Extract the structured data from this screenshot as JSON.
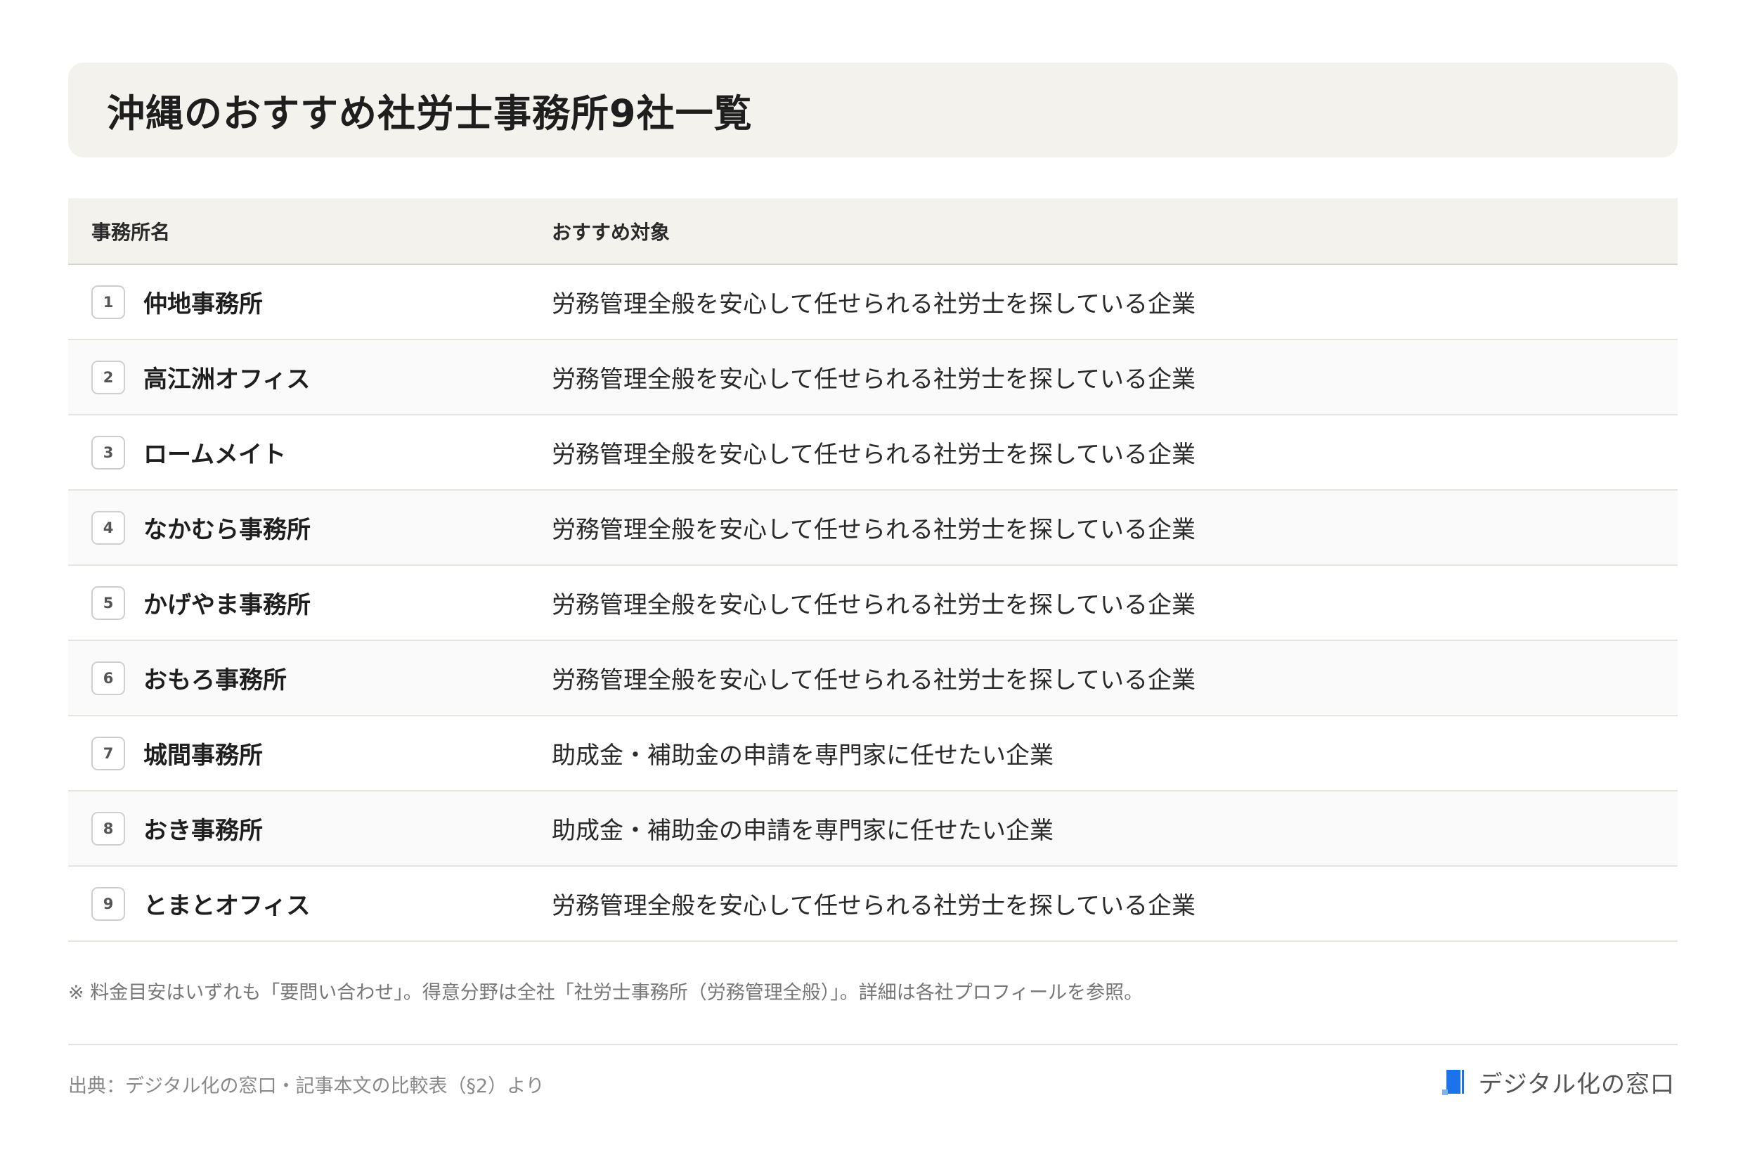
{
  "title": "沖縄のおすすめ社労士事務所9社一覧",
  "table": {
    "headers": {
      "name": "事務所名",
      "target": "おすすめ対象"
    },
    "rows": [
      {
        "num": "1",
        "name": "仲地事務所",
        "target": "労務管理全般を安心して任せられる社労士を探している企業"
      },
      {
        "num": "2",
        "name": "高江洲オフィス",
        "target": "労務管理全般を安心して任せられる社労士を探している企業"
      },
      {
        "num": "3",
        "name": "ロームメイト",
        "target": "労務管理全般を安心して任せられる社労士を探している企業"
      },
      {
        "num": "4",
        "name": "なかむら事務所",
        "target": "労務管理全般を安心して任せられる社労士を探している企業"
      },
      {
        "num": "5",
        "name": "かげやま事務所",
        "target": "労務管理全般を安心して任せられる社労士を探している企業"
      },
      {
        "num": "6",
        "name": "おもろ事務所",
        "target": "労務管理全般を安心して任せられる社労士を探している企業"
      },
      {
        "num": "7",
        "name": "城間事務所",
        "target": "助成金・補助金の申請を専門家に任せたい企業"
      },
      {
        "num": "8",
        "name": "おき事務所",
        "target": "助成金・補助金の申請を専門家に任せたい企業"
      },
      {
        "num": "9",
        "name": "とまとオフィス",
        "target": "労務管理全般を安心して任せられる社労士を探している企業"
      }
    ]
  },
  "note": "※ 料金目安はいずれも「要問い合わせ」。得意分野は全社「社労士事務所（労務管理全般）」。詳細は各社プロフィールを参照。",
  "source": "出典：デジタル化の窓口・記事本文の比較表（§2）より",
  "brand": {
    "name": "デジタル化の窓口",
    "icon": "document-logo-icon",
    "color": "#1a73e8"
  }
}
